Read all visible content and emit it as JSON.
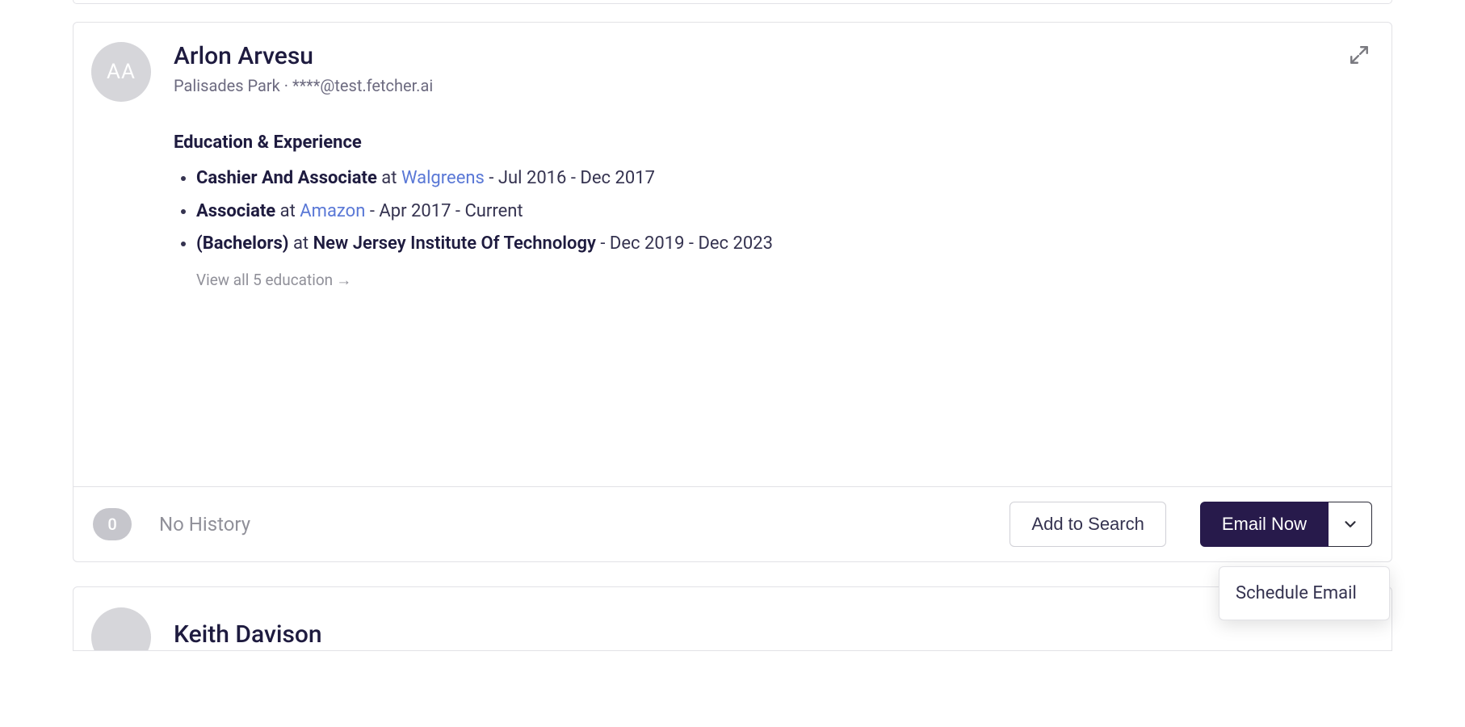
{
  "card": {
    "initials": "AA",
    "name": "Arlon Arvesu",
    "location": "Palisades Park",
    "email_masked": "****@test.fetcher.ai",
    "section_title": "Education & Experience",
    "items": [
      {
        "role": "Cashier And Associate",
        "at": "at",
        "org": "Walgreens",
        "org_type": "link",
        "dates": "Jul 2016 - Dec 2017"
      },
      {
        "role": "Associate",
        "at": "at",
        "org": "Amazon",
        "org_type": "link",
        "dates": "Apr 2017 - Current"
      },
      {
        "role": "(Bachelors)",
        "at": "at",
        "org": "New Jersey Institute Of Technology",
        "org_type": "bold",
        "dates": "Dec 2019 - Dec 2023"
      }
    ],
    "view_all_label": "View all 5 education",
    "history_count": "0",
    "history_label": "No History",
    "add_to_search_label": "Add to Search",
    "email_now_label": "Email Now",
    "dropdown": {
      "schedule_label": "Schedule Email"
    }
  },
  "next_card": {
    "name": "Keith Davison"
  }
}
